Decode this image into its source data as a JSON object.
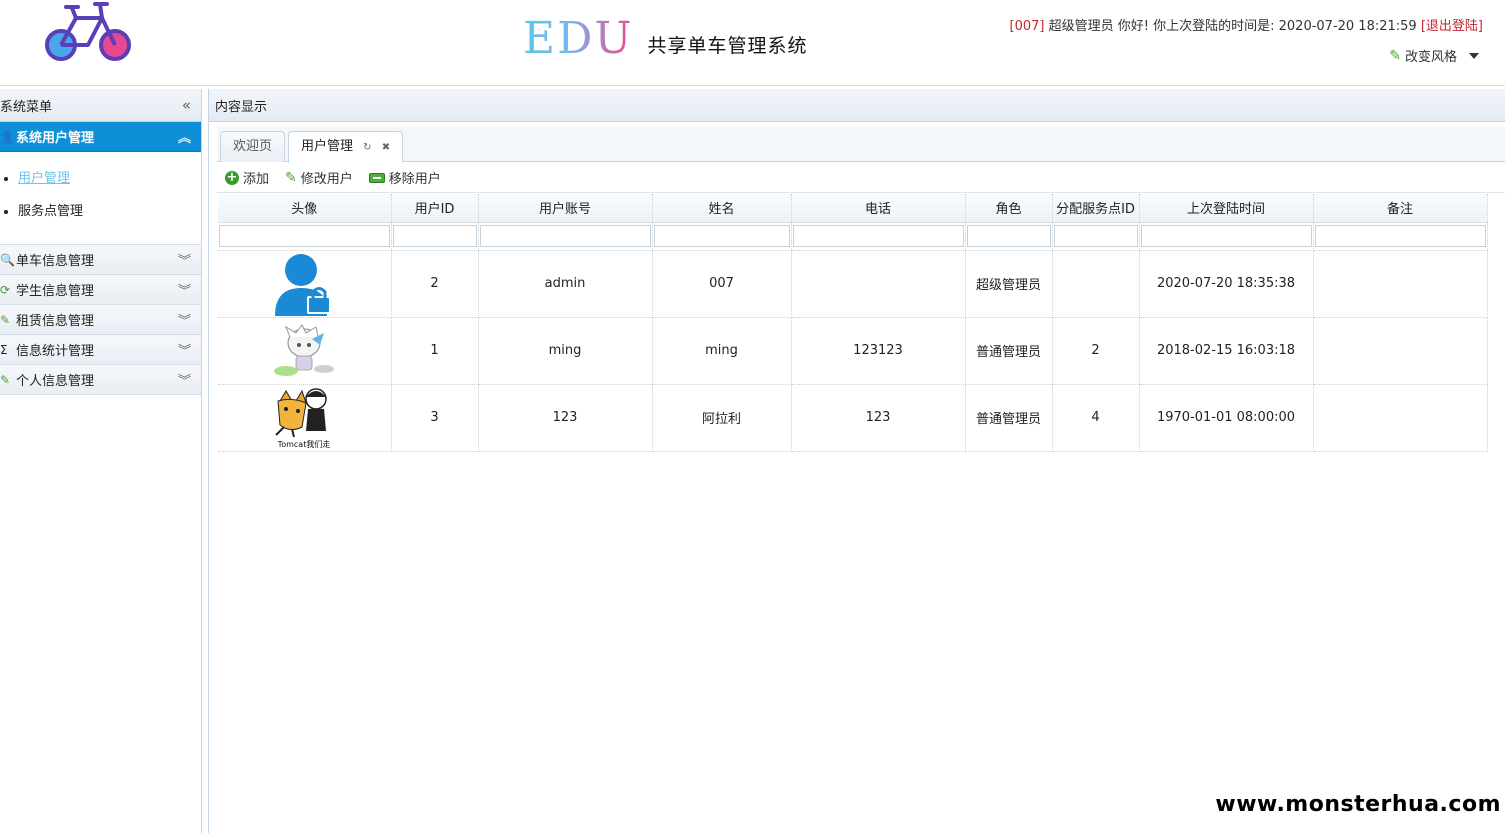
{
  "header": {
    "brand_main": "EDU",
    "brand_sub": "共享单车管理系统",
    "user_id": "[007]",
    "user_greeting": "超级管理员 你好! 你上次登陆的时间是:",
    "last_login": "2020-07-20 18:21:59",
    "logout_label": "[退出登陆]",
    "style_switch_label": "改变风格"
  },
  "sidebar": {
    "title": "系统菜单",
    "groups": [
      {
        "label": "系统用户管理",
        "icon": "user-icon",
        "items": [
          "用户管理",
          "服务点管理"
        ]
      },
      {
        "label": "单车信息管理",
        "icon": "search-icon"
      },
      {
        "label": "学生信息管理",
        "icon": "refresh-icon"
      },
      {
        "label": "租赁信息管理",
        "icon": "pencil-icon"
      },
      {
        "label": "信息统计管理",
        "icon": "sigma-icon"
      },
      {
        "label": "个人信息管理",
        "icon": "pencil-icon"
      }
    ]
  },
  "content": {
    "title": "内容显示",
    "tabs": [
      {
        "label": "欢迎页"
      },
      {
        "label": "用户管理"
      }
    ],
    "toolbar": {
      "add": "添加",
      "edit": "修改用户",
      "remove": "移除用户"
    },
    "columns": [
      "头像",
      "用户ID",
      "用户账号",
      "姓名",
      "电话",
      "角色",
      "分配服务点ID",
      "上次登陆时间",
      "备注"
    ],
    "rows": [
      {
        "avatar": "blue-user-lock-avatar",
        "id": "2",
        "account": "admin",
        "name": "007",
        "phone": "",
        "role": "超级管理员",
        "station": "",
        "last_login": "2020-07-20 18:35:38",
        "remark": ""
      },
      {
        "avatar": "anime-character-avatar",
        "id": "1",
        "account": "ming",
        "name": "ming",
        "phone": "123123",
        "role": "普通管理员",
        "station": "2",
        "last_login": "2018-02-15 16:03:18",
        "remark": ""
      },
      {
        "avatar": "tomcat-avatar",
        "avatar_caption": "Tomcat我们走",
        "id": "3",
        "account": "123",
        "name": "阿拉利",
        "phone": "123",
        "role": "普通管理员",
        "station": "4",
        "last_login": "1970-01-01 08:00:00",
        "remark": ""
      }
    ]
  },
  "watermark": "www.monsterhua.com",
  "colors": {
    "accent": "#0e8fd8",
    "alert": "#c6262e",
    "link": "#6cc6ef"
  }
}
